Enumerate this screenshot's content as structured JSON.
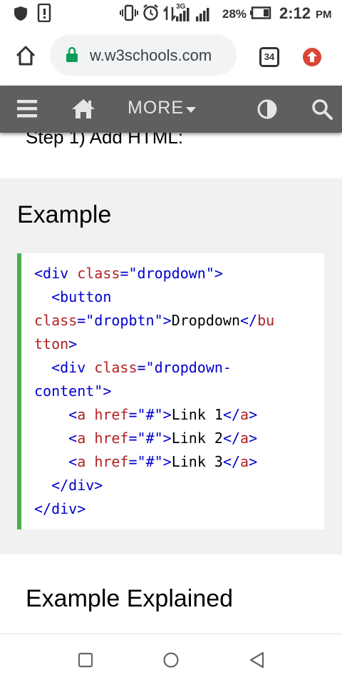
{
  "status_bar": {
    "network_label": "3G",
    "battery_percent": "28%",
    "time": "2:12",
    "time_suffix": "PM"
  },
  "browser": {
    "url": "w.w3schools.com",
    "tab_count": "34"
  },
  "w3_nav": {
    "more_label": "MORE"
  },
  "content": {
    "step_title": "Step 1) Add HTML:",
    "example_title": "Example",
    "code_lines": [
      [
        {
          "c": "t",
          "s": "<div "
        },
        {
          "c": "a",
          "s": "class"
        },
        {
          "c": "v",
          "s": "=\"dropdown\""
        },
        {
          "c": "t",
          "s": ">"
        }
      ],
      [
        {
          "c": "t",
          "s": "  <button"
        }
      ],
      [
        {
          "c": "a",
          "s": "class"
        },
        {
          "c": "v",
          "s": "=\"dropbtn\""
        },
        {
          "c": "t",
          "s": ">"
        },
        {
          "c": "x",
          "s": "Dropdown"
        },
        {
          "c": "t",
          "s": "</"
        },
        {
          "c": "a",
          "s": "bu"
        }
      ],
      [
        {
          "c": "a",
          "s": "tton"
        },
        {
          "c": "t",
          "s": ">"
        }
      ],
      [
        {
          "c": "t",
          "s": "  <div "
        },
        {
          "c": "a",
          "s": "class"
        },
        {
          "c": "v",
          "s": "=\"dropdown-"
        }
      ],
      [
        {
          "c": "v",
          "s": "content\""
        },
        {
          "c": "t",
          "s": ">"
        }
      ],
      [
        {
          "c": "t",
          "s": "    <"
        },
        {
          "c": "a",
          "s": "a "
        },
        {
          "c": "a",
          "s": "href"
        },
        {
          "c": "v",
          "s": "=\"#\""
        },
        {
          "c": "t",
          "s": ">"
        },
        {
          "c": "x",
          "s": "Link 1"
        },
        {
          "c": "t",
          "s": "</"
        },
        {
          "c": "a",
          "s": "a"
        },
        {
          "c": "t",
          "s": ">"
        }
      ],
      [
        {
          "c": "t",
          "s": "    <"
        },
        {
          "c": "a",
          "s": "a "
        },
        {
          "c": "a",
          "s": "href"
        },
        {
          "c": "v",
          "s": "=\"#\""
        },
        {
          "c": "t",
          "s": ">"
        },
        {
          "c": "x",
          "s": "Link 2"
        },
        {
          "c": "t",
          "s": "</"
        },
        {
          "c": "a",
          "s": "a"
        },
        {
          "c": "t",
          "s": ">"
        }
      ],
      [
        {
          "c": "t",
          "s": "    <"
        },
        {
          "c": "a",
          "s": "a "
        },
        {
          "c": "a",
          "s": "href"
        },
        {
          "c": "v",
          "s": "=\"#\""
        },
        {
          "c": "t",
          "s": ">"
        },
        {
          "c": "x",
          "s": "Link 3"
        },
        {
          "c": "t",
          "s": "</"
        },
        {
          "c": "a",
          "s": "a"
        },
        {
          "c": "t",
          "s": ">"
        }
      ],
      [
        {
          "c": "t",
          "s": "  </div>"
        }
      ],
      [
        {
          "c": "t",
          "s": "</div>"
        }
      ]
    ],
    "explained_title": "Example Explained"
  },
  "colors": {
    "w3_nav_bg": "#5f5f5f",
    "example_bg": "#f1f1f1",
    "code_accent": "#4caf50",
    "tag_color": "#0000cd",
    "attr_color": "#b22222",
    "lock_green": "#0f9d58",
    "update_red": "#db4437"
  }
}
